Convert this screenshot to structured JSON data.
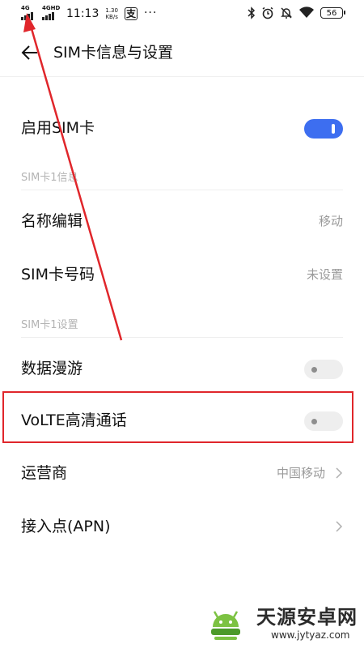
{
  "status_bar": {
    "sim1_network": "4G",
    "sim2_network": "4GHD",
    "time": "11:13",
    "net_speed_value": "1.30",
    "net_speed_unit": "KB/s",
    "app_notification": "支",
    "more_indicator": "···",
    "battery": "56",
    "icons": [
      "bluetooth-icon",
      "alarm-icon",
      "mute-icon",
      "wifi-icon",
      "battery-icon"
    ]
  },
  "header": {
    "back_icon": "arrow-left-icon",
    "title": "SIM卡信息与设置"
  },
  "rows": {
    "enable_sim": {
      "label": "启用SIM卡",
      "enabled": true
    },
    "name_edit": {
      "label": "名称编辑",
      "value": "移动"
    },
    "sim_number": {
      "label": "SIM卡号码",
      "value": "未设置"
    },
    "data_roaming": {
      "label": "数据漫游",
      "enabled": false
    },
    "volte": {
      "label": "VoLTE高清通话",
      "enabled": false
    },
    "carrier": {
      "label": "运营商",
      "value": "中国移动"
    },
    "apn": {
      "label": "接入点(APN)"
    }
  },
  "sections": {
    "sim_info": "SIM卡1信息",
    "sim_settings": "SIM卡1设置"
  },
  "annotation": {
    "color": "#e0262b"
  },
  "watermark": {
    "name": "天源安卓网",
    "url": "www.jytyaz.com"
  },
  "colors": {
    "accent": "#3d6ef0",
    "secondary_text": "#9a9a9a",
    "section_text": "#b4b4b4"
  }
}
